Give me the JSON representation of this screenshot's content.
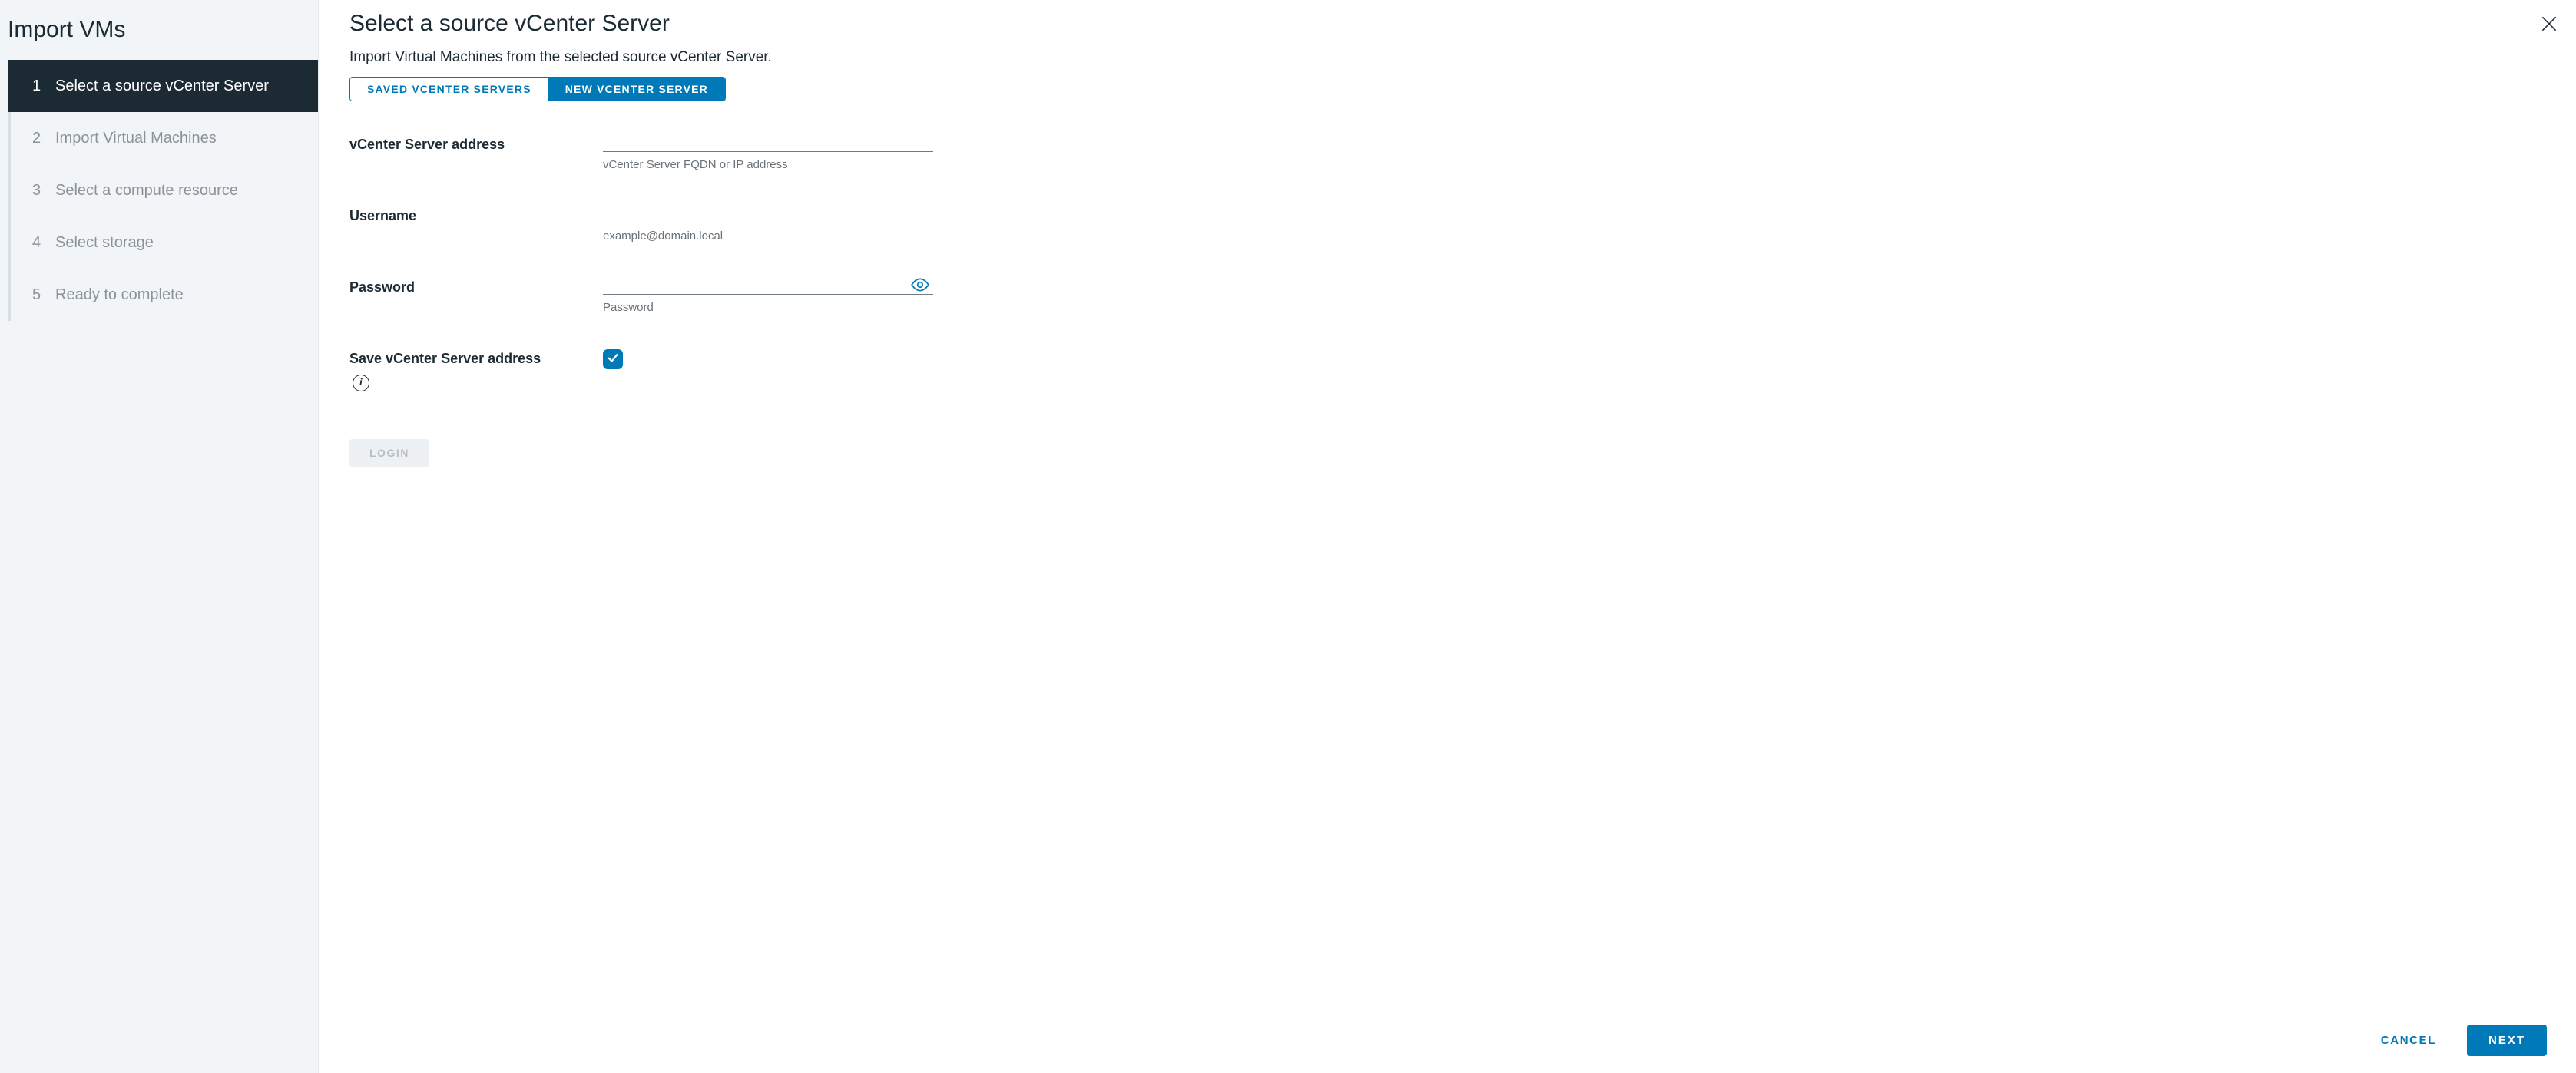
{
  "sidebar": {
    "title": "Import VMs",
    "steps": [
      {
        "num": "1",
        "label": "Select a source vCenter Server",
        "active": true
      },
      {
        "num": "2",
        "label": "Import Virtual Machines",
        "active": false
      },
      {
        "num": "3",
        "label": "Select a compute resource",
        "active": false
      },
      {
        "num": "4",
        "label": "Select storage",
        "active": false
      },
      {
        "num": "5",
        "label": "Ready to complete",
        "active": false
      }
    ]
  },
  "main": {
    "heading": "Select a source vCenter Server",
    "subheading": "Import Virtual Machines from the selected source vCenter Server.",
    "tabs": {
      "saved": "SAVED VCENTER SERVERS",
      "new": "NEW VCENTER SERVER"
    },
    "form": {
      "address_label": "vCenter Server address",
      "address_value": "",
      "address_helper": "vCenter Server FQDN or IP address",
      "username_label": "Username",
      "username_value": "",
      "username_helper": "example@domain.local",
      "password_label": "Password",
      "password_value": "",
      "password_helper": "Password",
      "save_label": "Save vCenter Server address",
      "save_checked": true,
      "login_label": "LOGIN"
    }
  },
  "footer": {
    "cancel": "CANCEL",
    "next": "NEXT"
  }
}
